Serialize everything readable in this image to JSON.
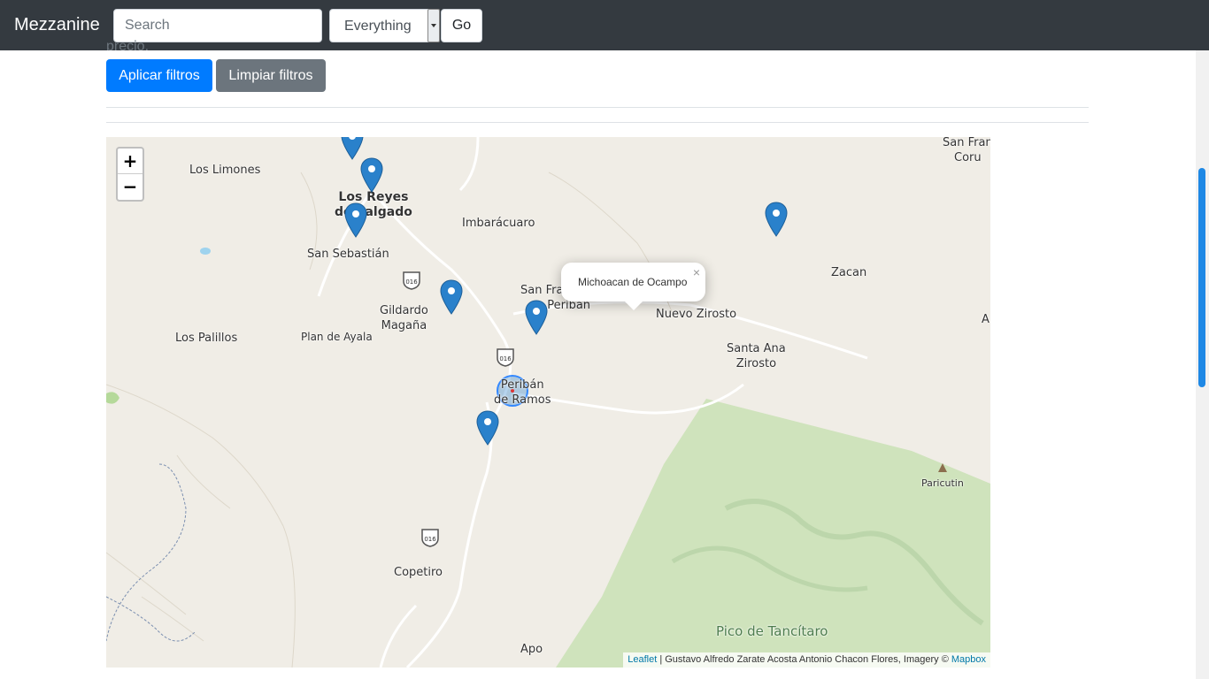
{
  "navbar": {
    "brand": "Mezzanine",
    "search_placeholder": "Search",
    "select_value": "Everything",
    "go_label": "Go"
  },
  "filters": {
    "cut_text": "precio.",
    "apply_label": "Aplicar filtros",
    "clear_label": "Limpiar filtros"
  },
  "map": {
    "zoom_in": "+",
    "zoom_out": "−",
    "labels": {
      "los_limones": "Los Limones",
      "los_reyes": "Los Reyes de Salgado",
      "los_reyes_1": "Los Reyes",
      "los_reyes_2": "de Salgado",
      "imbaracuaro": "Imbarácuaro",
      "san_sebastian": "San Sebastián",
      "gildardo_1": "Gildardo",
      "gildardo_2": "Magaña",
      "plan_de_ayala": "Plan de Ayala",
      "los_palillos": "Los Palillos",
      "san_francisco_1": "San Francisco",
      "san_francisco_2": "Periban",
      "nuevo_zirosto": "Nuevo Zirosto",
      "santa_ana_1": "Santa Ana",
      "santa_ana_2": "Zirosto",
      "zacan": "Zacan",
      "periban_1": "Peribán",
      "periban_2": "de Ramos",
      "paricutin": "Paricutin",
      "copetiro": "Copetiro",
      "apo": "Apo",
      "pico": "Pico de Tancítaro",
      "san_fran_top_1": "San Fran",
      "san_fran_top_2": "Coru",
      "a_edge": "A",
      "route": "016"
    },
    "popup_text": "Michoacan de Ocampo",
    "popup_close": "×",
    "attribution": {
      "leaflet": "Leaflet",
      "text": " | Gustavo Alfredo Zarate Acosta Antonio Chacon Flores, Imagery © ",
      "mapbox": "Mapbox"
    }
  },
  "colors": {
    "navbar_bg": "#343a40",
    "primary": "#007bff",
    "secondary": "#6c757d",
    "marker": "#2a81cb",
    "park": "#c9e0b4"
  }
}
